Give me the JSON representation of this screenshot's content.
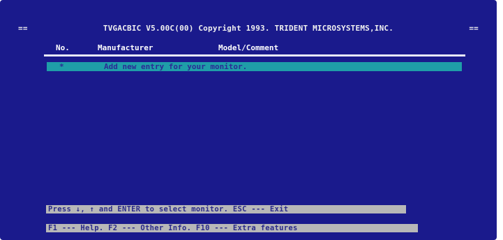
{
  "title_bar": {
    "left_marker": "==",
    "text": "TVGACBIC V5.00C(00) Copyright 1993. TRIDENT MICROSYSTEMS,INC.",
    "right_marker": "=="
  },
  "table": {
    "headers": {
      "no": "No.",
      "manufacturer": "Manufacturer",
      "model": "Model/Comment"
    },
    "rows": [
      {
        "marker": "*",
        "text": "Add new entry for your monitor."
      }
    ]
  },
  "footer": {
    "hint_line_1": "Press ↓, ↑ and ENTER to select monitor.  ESC --- Exit",
    "hint_line_2": "F1 --- Help.  F2 --- Other Info.  F10 --- Extra features"
  },
  "colors": {
    "background": "#1a1a8c",
    "selection": "#1f9ea8",
    "hint_bar": "#b8b8b8"
  }
}
